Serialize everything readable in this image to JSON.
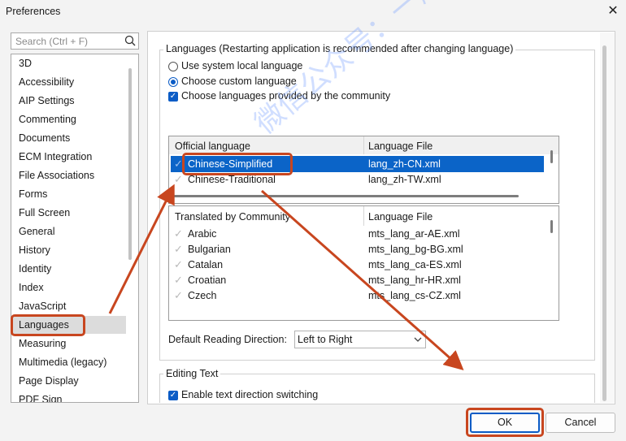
{
  "window": {
    "title": "Preferences"
  },
  "search": {
    "placeholder": "Search (Ctrl + F)"
  },
  "categories": [
    "3D",
    "Accessibility",
    "AIP Settings",
    "Commenting",
    "Documents",
    "ECM Integration",
    "File Associations",
    "Forms",
    "Full Screen",
    "General",
    "History",
    "Identity",
    "Index",
    "JavaScript",
    "Languages",
    "Measuring",
    "Multimedia (legacy)",
    "Page Display",
    "PDF Sign"
  ],
  "selected_category": "Languages",
  "languages": {
    "group_title": "Languages (Restarting application is recommended after changing language)",
    "opt_system": "Use system local language",
    "opt_custom": "Choose custom language",
    "opt_community": "Choose languages provided by the community",
    "official": {
      "col1": "Official language",
      "col2": "Language File",
      "rows": [
        {
          "name": "Chinese-Simplified",
          "file": "lang_zh-CN.xml"
        },
        {
          "name": "Chinese-Traditional",
          "file": "lang_zh-TW.xml"
        }
      ]
    },
    "community": {
      "col1": "Translated by Community",
      "col2": "Language File",
      "rows": [
        {
          "name": "Arabic",
          "file": "mts_lang_ar-AE.xml"
        },
        {
          "name": "Bulgarian",
          "file": "mts_lang_bg-BG.xml"
        },
        {
          "name": "Catalan",
          "file": "mts_lang_ca-ES.xml"
        },
        {
          "name": "Croatian",
          "file": "mts_lang_hr-HR.xml"
        },
        {
          "name": "Czech",
          "file": "mts_lang_cs-CZ.xml"
        }
      ]
    },
    "reading_dir_label": "Default Reading Direction:",
    "reading_dir_value": "Left to Right"
  },
  "editing": {
    "group_title": "Editing Text",
    "opt_direction": "Enable text direction switching"
  },
  "buttons": {
    "ok": "OK",
    "cancel": "Cancel"
  },
  "watermark": "微信公众号：一起学资源库",
  "colors": {
    "accent": "#0b5cc6",
    "highlight": "#0b64c8",
    "annotation": "#c8461f"
  }
}
